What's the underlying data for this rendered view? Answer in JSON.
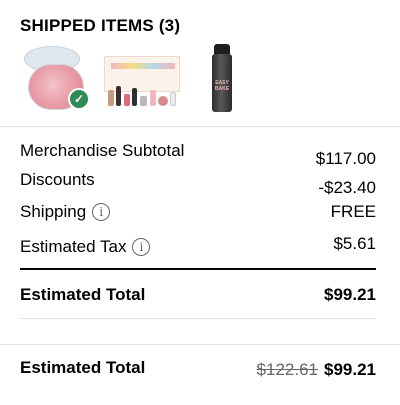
{
  "section": {
    "title": "SHIPPED ITEMS (3)"
  },
  "products": [
    {
      "icon": "loose-powder-jar-icon",
      "badge": "clean-check-badge"
    },
    {
      "icon": "gift-set-box-icon"
    },
    {
      "icon": "spray-can-icon",
      "can_label": "EASY BAKE"
    }
  ],
  "summary": {
    "subtotal_label": "Merchandise Subtotal",
    "subtotal_value": "$117.00",
    "discounts_label": "Discounts",
    "discounts_value": "-$23.40",
    "shipping_label": "Shipping",
    "shipping_value": "FREE",
    "tax_label": "Estimated Tax",
    "tax_value": "$5.61",
    "total_label": "Estimated Total",
    "total_value": "$99.21"
  },
  "footer": {
    "total_label": "Estimated Total",
    "original_value": "$122.61",
    "total_value": "$99.21"
  },
  "colors": {
    "badge": "#2e8b57",
    "rule": "#000000",
    "divider": "#e2e2e2"
  }
}
